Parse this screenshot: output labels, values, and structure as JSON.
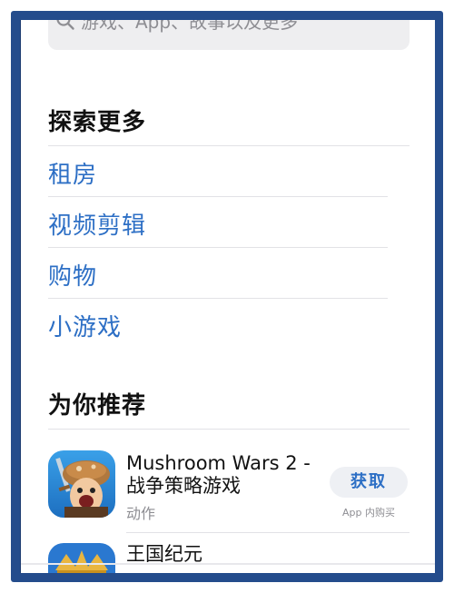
{
  "search": {
    "placeholder": "游戏、App、故事以及更多"
  },
  "explore": {
    "title": "探索更多",
    "items": [
      {
        "label": "租房"
      },
      {
        "label": "视频剪辑"
      },
      {
        "label": "购物"
      },
      {
        "label": "小游戏"
      }
    ]
  },
  "recommended": {
    "title": "为你推荐",
    "apps": [
      {
        "title_line1": "Mushroom Wars 2 -",
        "title_line2": "战争策略游戏",
        "category": "动作",
        "button_label": "获取",
        "iap_note": "App 内购买"
      },
      {
        "title_line1": "王国纪元"
      }
    ]
  },
  "colors": {
    "accent": "#2d6fc5",
    "frame": "#244c8c"
  }
}
